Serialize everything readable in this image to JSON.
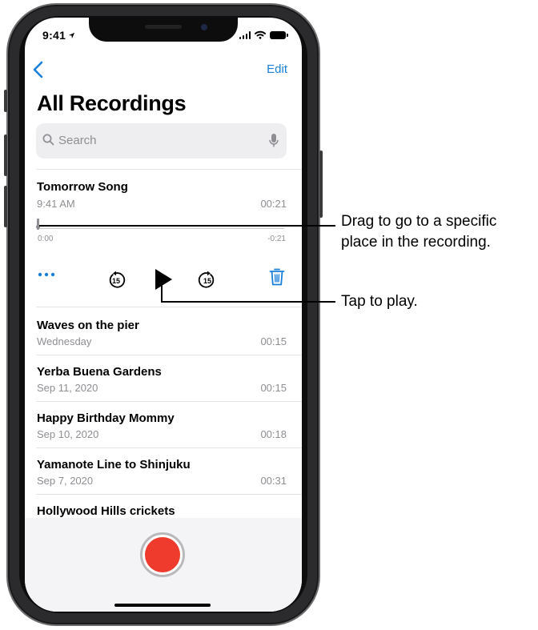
{
  "status": {
    "time": "9:41"
  },
  "nav": {
    "edit_label": "Edit",
    "title": "All Recordings"
  },
  "search": {
    "placeholder": "Search"
  },
  "expanded": {
    "title": "Tomorrow Song",
    "date": "9:41 AM",
    "duration": "00:21",
    "elapsed": "0:00",
    "remaining": "-0:21",
    "progress": 0
  },
  "recordings": [
    {
      "title": "Waves on the pier",
      "date": "Wednesday",
      "duration": "00:15"
    },
    {
      "title": "Yerba Buena Gardens",
      "date": "Sep 11, 2020",
      "duration": "00:15"
    },
    {
      "title": "Happy Birthday Mommy",
      "date": "Sep 10, 2020",
      "duration": "00:18"
    },
    {
      "title": "Yamanote Line to Shinjuku",
      "date": "Sep 7, 2020",
      "duration": "00:31"
    },
    {
      "title": "Hollywood Hills crickets"
    }
  ],
  "callouts": {
    "scrub_line1": "Drag to go to a specific",
    "scrub_line2": "place in the recording.",
    "play": "Tap to play."
  },
  "icons": {
    "back": "chevron-left-icon",
    "search": "search-icon",
    "mic": "microphone-icon",
    "more": "ellipsis-icon",
    "skip_back": "skip-back-15-icon",
    "play": "play-icon",
    "skip_forward": "skip-forward-15-icon",
    "delete": "trash-icon",
    "record": "record-icon"
  },
  "colors": {
    "accent": "#1a7fdb",
    "record": "#ef3b2d"
  }
}
